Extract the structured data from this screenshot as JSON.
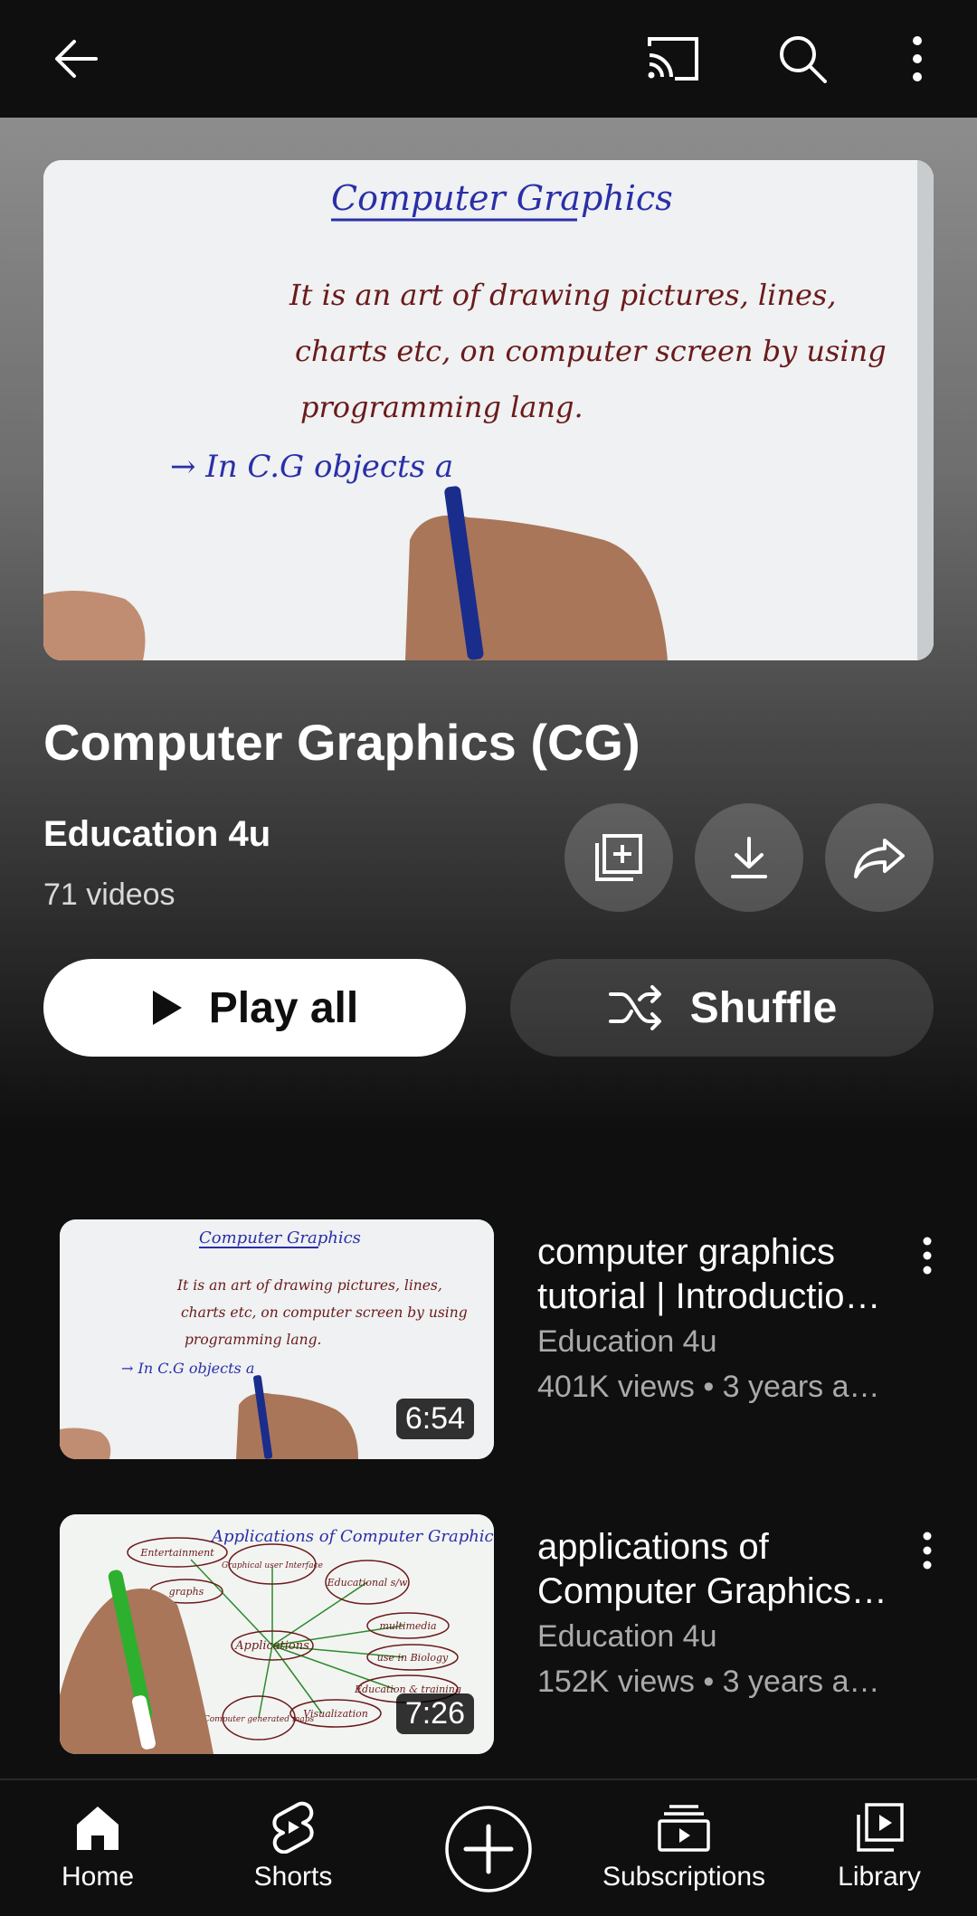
{
  "topbar": {
    "back_icon": "arrow-left-icon",
    "cast_icon": "cast-icon",
    "search_icon": "search-icon",
    "more_icon": "more-vertical-icon"
  },
  "playlist": {
    "title": "Computer Graphics (CG)",
    "channel": "Education 4u",
    "video_count": "71 videos",
    "hero_board": {
      "heading": "Computer Graphics",
      "line1": "It is an art of drawing pictures, lines,",
      "line2": "charts etc, on computer screen by using",
      "line3": "programming lang.",
      "line4": "→ In C.G objects a"
    },
    "actions": {
      "save_icon": "playlist-add-icon",
      "download_icon": "download-icon",
      "share_icon": "share-icon"
    },
    "play_all_label": "Play all",
    "shuffle_label": "Shuffle"
  },
  "videos": [
    {
      "title_line1": "computer graphics",
      "title_line2": "tutorial | Introductio…",
      "channel": "Education 4u",
      "stats": "401K views • 3 years a…",
      "duration": "6:54",
      "board": {
        "heading": "Computer Graphics",
        "line1": "It is an art of drawing pictures, lines,",
        "line2": "charts etc, on computer screen by using",
        "line3": "programming lang.",
        "line4": "→ In C.G objects a"
      }
    },
    {
      "title_line1": "applications of",
      "title_line2": "Computer Graphics…",
      "channel": "Education 4u",
      "stats": "152K views • 3 years a…",
      "duration": "7:26",
      "board": {
        "heading": "Applications of Computer Graphics",
        "center": "Applications",
        "n1": "Entertainment",
        "n2": "Graphical user Interface",
        "n3": "Educational s/w",
        "n4": "multimedia",
        "n5": "use in Biology",
        "n6": "Education & training",
        "n7": "Visualization",
        "n8": "Computer generated maps",
        "n9": "graphs"
      }
    }
  ],
  "bottom_nav": {
    "home": "Home",
    "shorts": "Shorts",
    "subscriptions": "Subscriptions",
    "library": "Library",
    "create_icon": "create-plus-icon"
  }
}
